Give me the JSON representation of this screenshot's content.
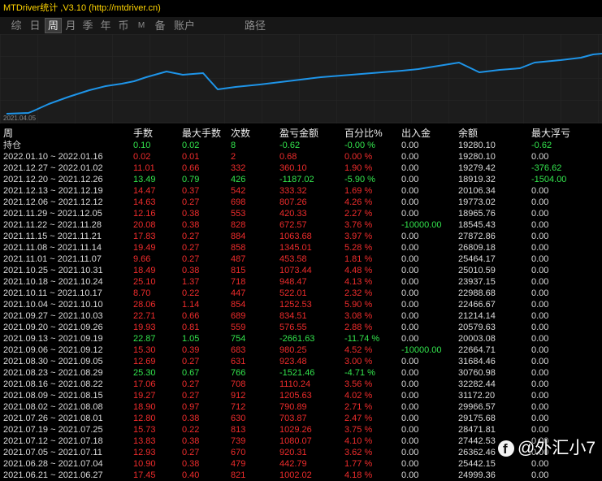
{
  "window": {
    "title": "MTDriver统计 ,V3.10 (http://mtdriver.cn)"
  },
  "tabs": {
    "items": [
      "综",
      "日",
      "周",
      "月",
      "季",
      "年",
      "币",
      "M",
      "备",
      "账户"
    ],
    "selected": "周"
  },
  "path_button": "路径",
  "chart": {
    "start_date": "2021.04.05",
    "line_color": "#1e94e8"
  },
  "colors": {
    "title": "#ffd400",
    "profit": "#f02c2c",
    "loss": "#33e54d",
    "text": "#dcdcdc"
  },
  "table": {
    "columns": [
      "周",
      "手数",
      "最大手数",
      "次数",
      "盈亏金额",
      "百分比%",
      "出入金",
      "余额",
      "最大浮亏"
    ],
    "position_row": {
      "label": "持仓",
      "lots": "0.10",
      "max_lots": "0.02",
      "trades": "8",
      "pnl": "-0.62",
      "percent": "-0.00 %",
      "deposit": "0.00",
      "balance": "19280.10",
      "max_floating_loss": "-0.62"
    },
    "rows": [
      {
        "period": "2022.01.10 ~ 2022.01.16",
        "lots": "0.02",
        "max_lots": "0.01",
        "trades": "2",
        "pnl": "0.68",
        "percent": "0.00 %",
        "deposit": "0.00",
        "balance": "19280.10",
        "max_floating_loss": "0.00"
      },
      {
        "period": "2021.12.27 ~ 2022.01.02",
        "lots": "11.01",
        "max_lots": "0.66",
        "trades": "332",
        "pnl": "360.10",
        "percent": "1.90 %",
        "deposit": "0.00",
        "balance": "19279.42",
        "max_floating_loss": "-376.62"
      },
      {
        "period": "2021.12.20 ~ 2021.12.26",
        "lots": "13.49",
        "max_lots": "0.79",
        "trades": "426",
        "pnl": "-1187.02",
        "percent": "-5.90 %",
        "deposit": "0.00",
        "balance": "18919.32",
        "max_floating_loss": "-1504.00"
      },
      {
        "period": "2021.12.13 ~ 2021.12.19",
        "lots": "14.47",
        "max_lots": "0.37",
        "trades": "542",
        "pnl": "333.32",
        "percent": "1.69 %",
        "deposit": "0.00",
        "balance": "20106.34",
        "max_floating_loss": "0.00"
      },
      {
        "period": "2021.12.06 ~ 2021.12.12",
        "lots": "14.63",
        "max_lots": "0.27",
        "trades": "698",
        "pnl": "807.26",
        "percent": "4.26 %",
        "deposit": "0.00",
        "balance": "19773.02",
        "max_floating_loss": "0.00"
      },
      {
        "period": "2021.11.29 ~ 2021.12.05",
        "lots": "12.16",
        "max_lots": "0.38",
        "trades": "553",
        "pnl": "420.33",
        "percent": "2.27 %",
        "deposit": "0.00",
        "balance": "18965.76",
        "max_floating_loss": "0.00"
      },
      {
        "period": "2021.11.22 ~ 2021.11.28",
        "lots": "20.08",
        "max_lots": "0.38",
        "trades": "828",
        "pnl": "672.57",
        "percent": "3.76 %",
        "deposit": "-10000.00",
        "balance": "18545.43",
        "max_floating_loss": "0.00"
      },
      {
        "period": "2021.11.15 ~ 2021.11.21",
        "lots": "17.83",
        "max_lots": "0.27",
        "trades": "884",
        "pnl": "1063.68",
        "percent": "3.97 %",
        "deposit": "0.00",
        "balance": "27872.86",
        "max_floating_loss": "0.00"
      },
      {
        "period": "2021.11.08 ~ 2021.11.14",
        "lots": "19.49",
        "max_lots": "0.27",
        "trades": "858",
        "pnl": "1345.01",
        "percent": "5.28 %",
        "deposit": "0.00",
        "balance": "26809.18",
        "max_floating_loss": "0.00"
      },
      {
        "period": "2021.11.01 ~ 2021.11.07",
        "lots": "9.66",
        "max_lots": "0.27",
        "trades": "487",
        "pnl": "453.58",
        "percent": "1.81 %",
        "deposit": "0.00",
        "balance": "25464.17",
        "max_floating_loss": "0.00"
      },
      {
        "period": "2021.10.25 ~ 2021.10.31",
        "lots": "18.49",
        "max_lots": "0.38",
        "trades": "815",
        "pnl": "1073.44",
        "percent": "4.48 %",
        "deposit": "0.00",
        "balance": "25010.59",
        "max_floating_loss": "0.00"
      },
      {
        "period": "2021.10.18 ~ 2021.10.24",
        "lots": "25.10",
        "max_lots": "1.37",
        "trades": "718",
        "pnl": "948.47",
        "percent": "4.13 %",
        "deposit": "0.00",
        "balance": "23937.15",
        "max_floating_loss": "0.00"
      },
      {
        "period": "2021.10.11 ~ 2021.10.17",
        "lots": "8.70",
        "max_lots": "0.22",
        "trades": "447",
        "pnl": "522.01",
        "percent": "2.32 %",
        "deposit": "0.00",
        "balance": "22988.68",
        "max_floating_loss": "0.00"
      },
      {
        "period": "2021.10.04 ~ 2021.10.10",
        "lots": "28.06",
        "max_lots": "1.14",
        "trades": "854",
        "pnl": "1252.53",
        "percent": "5.90 %",
        "deposit": "0.00",
        "balance": "22466.67",
        "max_floating_loss": "0.00"
      },
      {
        "period": "2021.09.27 ~ 2021.10.03",
        "lots": "22.71",
        "max_lots": "0.66",
        "trades": "689",
        "pnl": "834.51",
        "percent": "3.08 %",
        "deposit": "0.00",
        "balance": "21214.14",
        "max_floating_loss": "0.00"
      },
      {
        "period": "2021.09.20 ~ 2021.09.26",
        "lots": "19.93",
        "max_lots": "0.81",
        "trades": "559",
        "pnl": "576.55",
        "percent": "2.88 %",
        "deposit": "0.00",
        "balance": "20579.63",
        "max_floating_loss": "0.00"
      },
      {
        "period": "2021.09.13 ~ 2021.09.19",
        "lots": "22.87",
        "max_lots": "1.05",
        "trades": "754",
        "pnl": "-2661.63",
        "percent": "-11.74 %",
        "deposit": "0.00",
        "balance": "20003.08",
        "max_floating_loss": "0.00"
      },
      {
        "period": "2021.09.06 ~ 2021.09.12",
        "lots": "15.30",
        "max_lots": "0.39",
        "trades": "683",
        "pnl": "980.25",
        "percent": "4.52 %",
        "deposit": "-10000.00",
        "balance": "22664.71",
        "max_floating_loss": "0.00"
      },
      {
        "period": "2021.08.30 ~ 2021.09.05",
        "lots": "12.69",
        "max_lots": "0.27",
        "trades": "631",
        "pnl": "923.48",
        "percent": "3.00 %",
        "deposit": "0.00",
        "balance": "31684.46",
        "max_floating_loss": "0.00"
      },
      {
        "period": "2021.08.23 ~ 2021.08.29",
        "lots": "25.30",
        "max_lots": "0.67",
        "trades": "766",
        "pnl": "-1521.46",
        "percent": "-4.71 %",
        "deposit": "0.00",
        "balance": "30760.98",
        "max_floating_loss": "0.00"
      },
      {
        "period": "2021.08.16 ~ 2021.08.22",
        "lots": "17.06",
        "max_lots": "0.27",
        "trades": "708",
        "pnl": "1110.24",
        "percent": "3.56 %",
        "deposit": "0.00",
        "balance": "32282.44",
        "max_floating_loss": "0.00"
      },
      {
        "period": "2021.08.09 ~ 2021.08.15",
        "lots": "19.27",
        "max_lots": "0.27",
        "trades": "912",
        "pnl": "1205.63",
        "percent": "4.02 %",
        "deposit": "0.00",
        "balance": "31172.20",
        "max_floating_loss": "0.00"
      },
      {
        "period": "2021.08.02 ~ 2021.08.08",
        "lots": "18.90",
        "max_lots": "0.97",
        "trades": "712",
        "pnl": "790.89",
        "percent": "2.71 %",
        "deposit": "0.00",
        "balance": "29966.57",
        "max_floating_loss": "0.00"
      },
      {
        "period": "2021.07.26 ~ 2021.08.01",
        "lots": "12.80",
        "max_lots": "0.38",
        "trades": "630",
        "pnl": "703.87",
        "percent": "2.47 %",
        "deposit": "0.00",
        "balance": "29175.68",
        "max_floating_loss": "0.00"
      },
      {
        "period": "2021.07.19 ~ 2021.07.25",
        "lots": "15.73",
        "max_lots": "0.22",
        "trades": "813",
        "pnl": "1029.26",
        "percent": "3.75 %",
        "deposit": "0.00",
        "balance": "28471.81",
        "max_floating_loss": "0.00"
      },
      {
        "period": "2021.07.12 ~ 2021.07.18",
        "lots": "13.83",
        "max_lots": "0.38",
        "trades": "739",
        "pnl": "1080.07",
        "percent": "4.10 %",
        "deposit": "0.00",
        "balance": "27442.53",
        "max_floating_loss": "0.00"
      },
      {
        "period": "2021.07.05 ~ 2021.07.11",
        "lots": "12.93",
        "max_lots": "0.27",
        "trades": "670",
        "pnl": "920.31",
        "percent": "3.62 %",
        "deposit": "0.00",
        "balance": "26362.46",
        "max_floating_loss": "0.00"
      },
      {
        "period": "2021.06.28 ~ 2021.07.04",
        "lots": "10.90",
        "max_lots": "0.38",
        "trades": "479",
        "pnl": "442.79",
        "percent": "1.77 %",
        "deposit": "0.00",
        "balance": "25442.15",
        "max_floating_loss": "0.00"
      },
      {
        "period": "2021.06.21 ~ 2021.06.27",
        "lots": "17.45",
        "max_lots": "0.40",
        "trades": "821",
        "pnl": "1002.02",
        "percent": "4.18 %",
        "deposit": "0.00",
        "balance": "24999.36",
        "max_floating_loss": "0.00"
      }
    ]
  },
  "watermark": {
    "text": "@外汇小7",
    "icon": "facebook-icon"
  }
}
